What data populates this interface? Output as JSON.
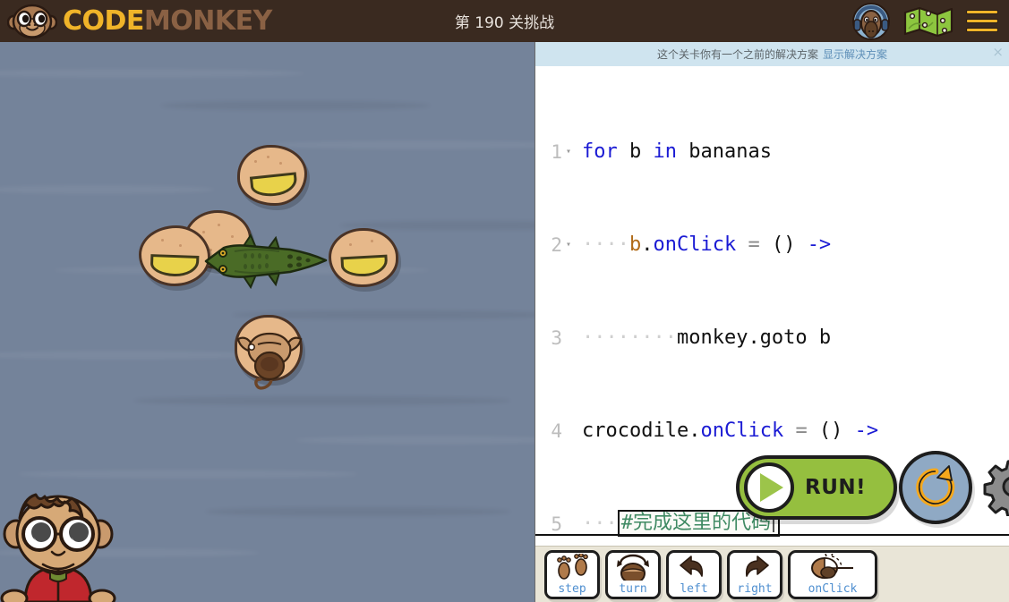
{
  "header": {
    "logo_code": "CODE",
    "logo_monkey": "MONKEY",
    "logo_icon": "monkey-head-icon",
    "title": "第 190 关挑战",
    "avatar_icon": "avatar-monkey-headphones-icon",
    "map_icon": "map-icon",
    "menu_icon": "hamburger-menu-icon",
    "background_color": "#3a2a20",
    "accent_color": "#f0b429"
  },
  "stage": {
    "water_color": "#74839a",
    "characters": [
      {
        "name": "banana-island-top",
        "type": "banana"
      },
      {
        "name": "sand-island-plain",
        "type": "sand"
      },
      {
        "name": "banana-island-left",
        "type": "banana"
      },
      {
        "name": "banana-island-right",
        "type": "banana"
      },
      {
        "name": "crocodile",
        "type": "crocodile"
      },
      {
        "name": "monkey-player",
        "type": "monkey"
      },
      {
        "name": "mascot-monkey",
        "type": "mascot"
      }
    ]
  },
  "notice": {
    "message": "这个关卡你有一个之前的解决方案",
    "link_label": "显示解决方案",
    "close_label": "×",
    "background_color": "#cfe4ef"
  },
  "editor": {
    "lines": [
      {
        "number": "1",
        "fold": "▾",
        "indent": "",
        "tokens": [
          {
            "text": "for",
            "cls": "kw"
          },
          {
            "text": " b ",
            "cls": "dark"
          },
          {
            "text": "in",
            "cls": "kw"
          },
          {
            "text": " bananas",
            "cls": "dark"
          }
        ]
      },
      {
        "number": "2",
        "fold": "▾",
        "indent": "····",
        "tokens": [
          {
            "text": "b",
            "cls": "var"
          },
          {
            "text": ".",
            "cls": "dark"
          },
          {
            "text": "onClick",
            "cls": "prop"
          },
          {
            "text": " ",
            "cls": "dark"
          },
          {
            "text": "=",
            "cls": "op"
          },
          {
            "text": " () ",
            "cls": "dark"
          },
          {
            "text": "->",
            "cls": "arrow"
          }
        ]
      },
      {
        "number": "3",
        "fold": "",
        "indent": "········",
        "tokens": [
          {
            "text": "monkey.goto b",
            "cls": "dark"
          }
        ]
      },
      {
        "number": "4",
        "fold": "",
        "indent": "",
        "tokens": [
          {
            "text": "crocodile",
            "cls": "dark"
          },
          {
            "text": ".",
            "cls": "dark"
          },
          {
            "text": "onClick",
            "cls": "prop"
          },
          {
            "text": " ",
            "cls": "dark"
          },
          {
            "text": "=",
            "cls": "op"
          },
          {
            "text": " () ",
            "cls": "dark"
          },
          {
            "text": "->",
            "cls": "arrow"
          }
        ]
      },
      {
        "number": "5",
        "fold": "",
        "indent": "···",
        "snippet": "#完成这里的代码",
        "tokens": []
      }
    ]
  },
  "controls": {
    "run_label": "RUN!",
    "run_icon": "play-icon",
    "run_color": "#95bf3f",
    "reset_icon": "reset-refresh-icon",
    "reset_color": "#8fa9c4",
    "gear_icon": "gear-settings-icon"
  },
  "toolbar": {
    "background_color": "#e9e5d7",
    "buttons": [
      {
        "label": "step",
        "icon": "footsteps-icon"
      },
      {
        "label": "turn",
        "icon": "turn-coconut-icon"
      },
      {
        "label": "left",
        "icon": "arrow-left-icon"
      },
      {
        "label": "right",
        "icon": "arrow-right-icon"
      },
      {
        "label": "onClick",
        "icon": "click-coconut-icon"
      }
    ]
  }
}
